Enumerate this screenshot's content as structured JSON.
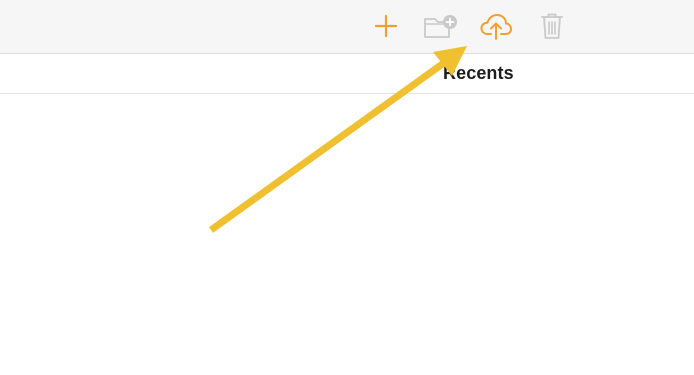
{
  "toolbar": {
    "buttons": [
      {
        "name": "add",
        "icon": "plus-icon",
        "enabled": true
      },
      {
        "name": "new-folder",
        "icon": "folder-plus-icon",
        "enabled": false
      },
      {
        "name": "upload",
        "icon": "cloud-upload-icon",
        "enabled": true
      },
      {
        "name": "delete",
        "icon": "trash-icon",
        "enabled": false
      }
    ]
  },
  "header": {
    "title": "Recents"
  },
  "colors": {
    "accent": "#f0a030",
    "disabled": "#c9c9c9",
    "annotation_arrow": "#f0c030"
  }
}
